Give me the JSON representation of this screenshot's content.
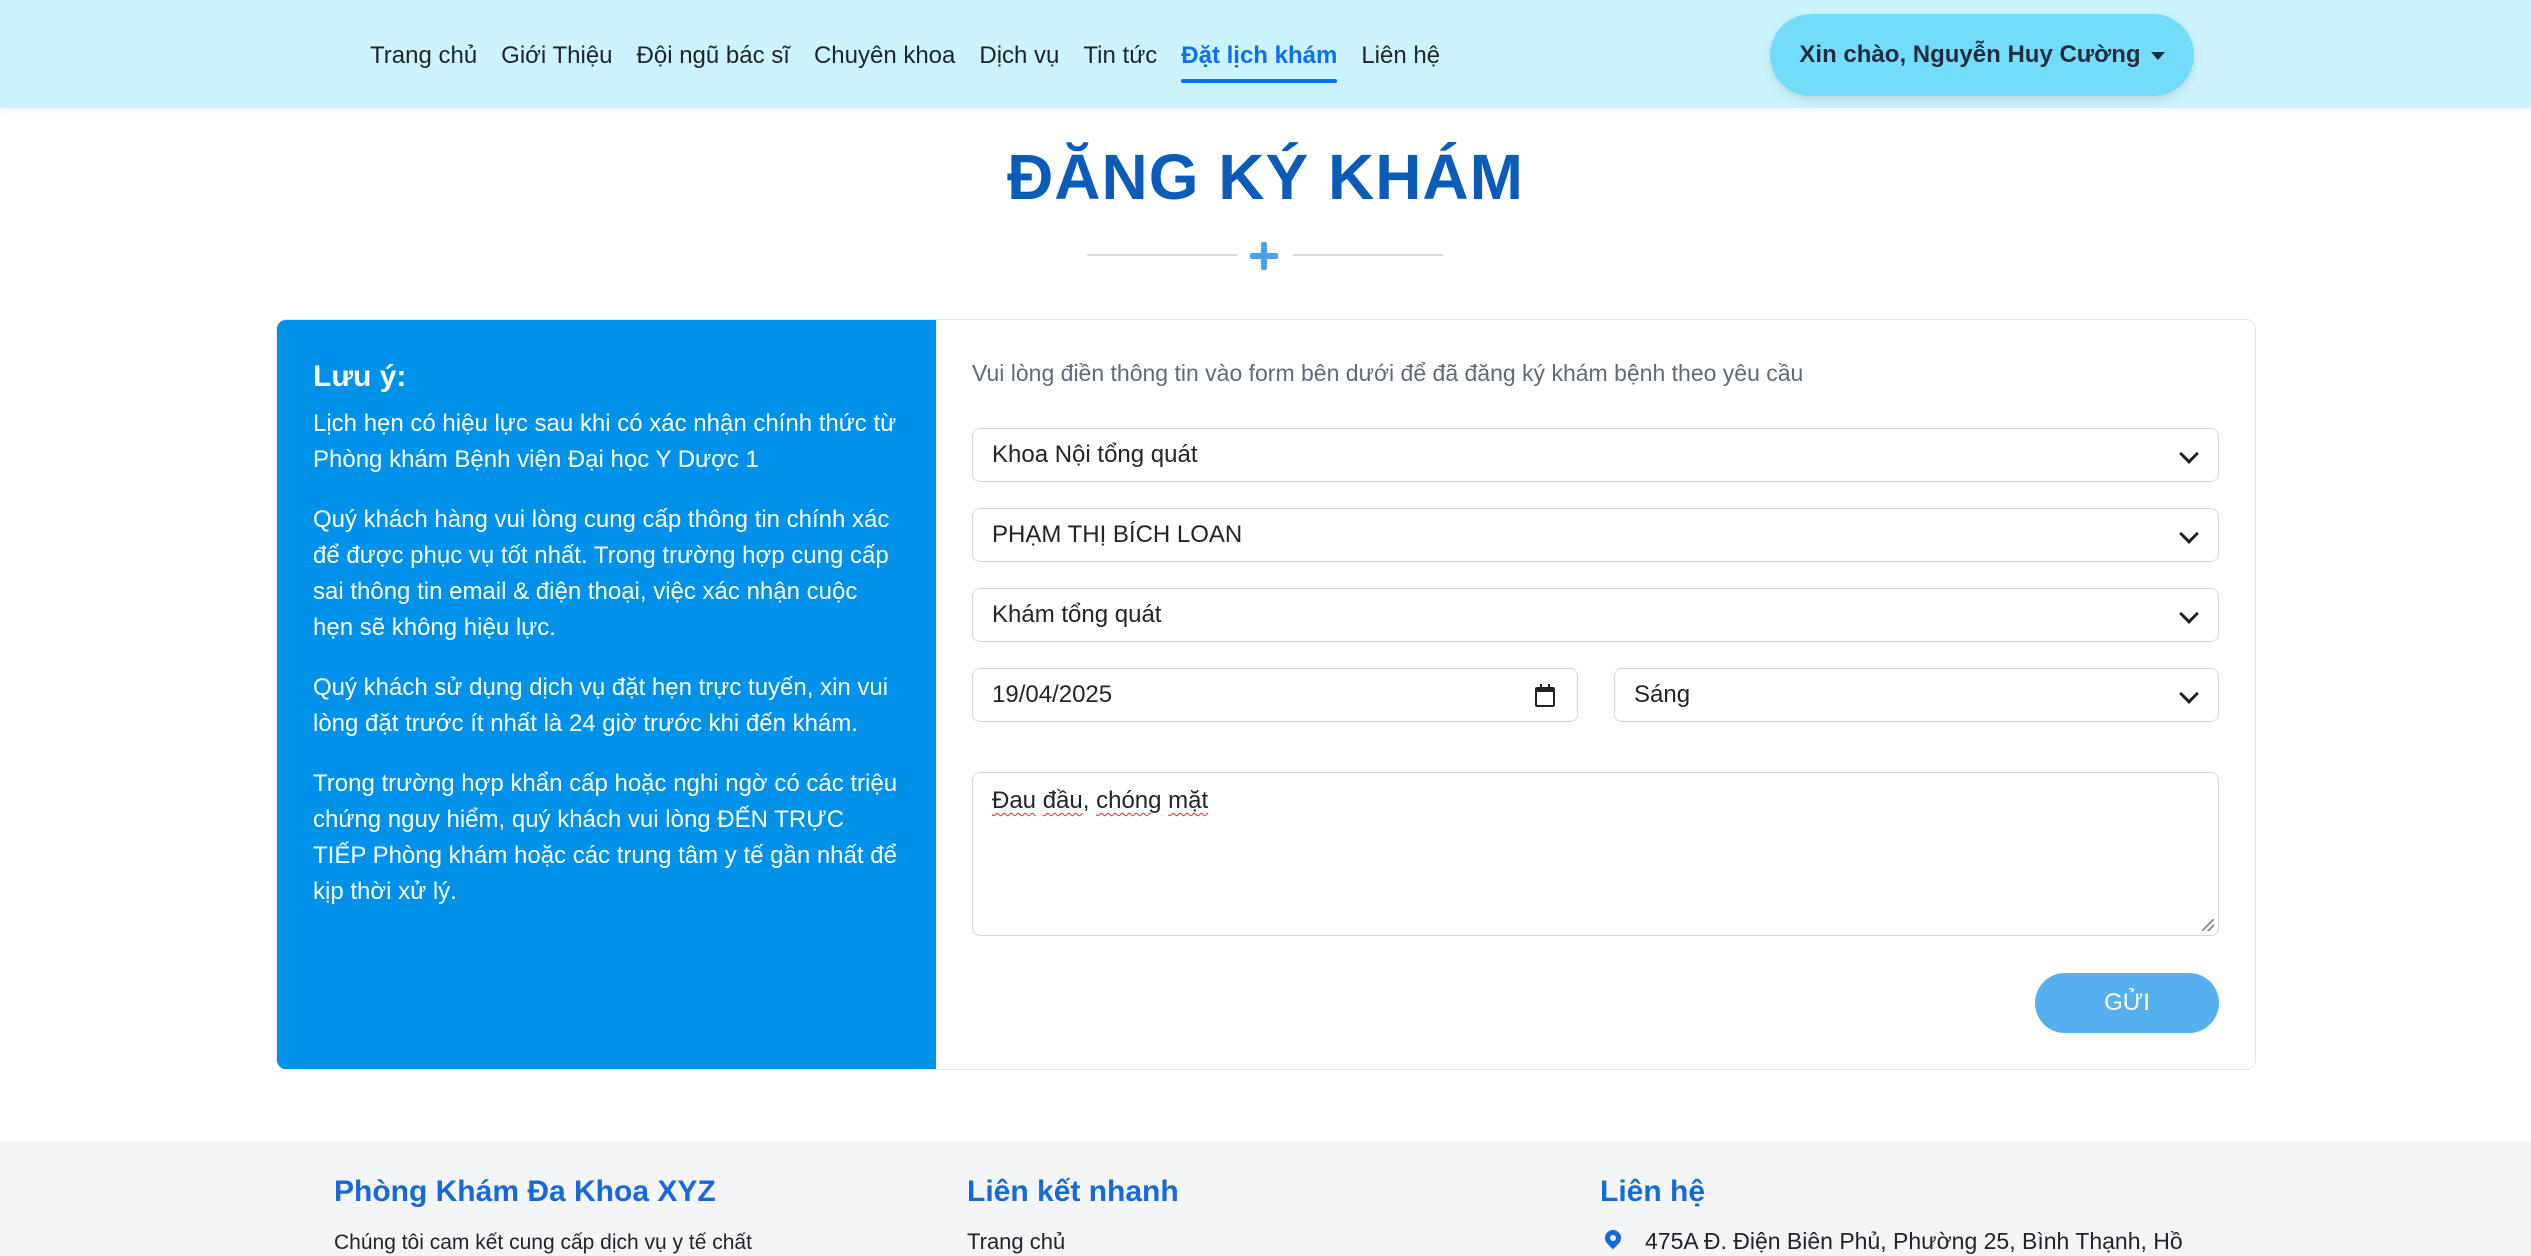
{
  "nav": {
    "items": [
      {
        "label": "Trang chủ"
      },
      {
        "label": "Giới Thiệu"
      },
      {
        "label": "Đội ngũ bác sĩ"
      },
      {
        "label": "Chuyên khoa"
      },
      {
        "label": "Dịch vụ"
      },
      {
        "label": "Tin tức"
      },
      {
        "label": "Đặt lịch khám",
        "active": true
      },
      {
        "label": "Liên hệ"
      }
    ],
    "user_greeting": "Xin chào, Nguyễn Huy Cường"
  },
  "page": {
    "title": "ĐĂNG KÝ KHÁM"
  },
  "note": {
    "title": "Lưu ý:",
    "paragraphs": [
      "Lịch hẹn có hiệu lực sau khi có xác nhận chính thức từ Phòng khám Bệnh viện Đại học Y Dược 1",
      "Quý khách hàng vui lòng cung cấp thông tin chính xác để được phục vụ tốt nhất. Trong trường hợp cung cấp sai thông tin email & điện thoại, việc xác nhận cuộc hẹn sẽ không hiệu lực.",
      "Quý khách sử dụng dịch vụ đặt hẹn trực tuyến, xin vui lòng đặt trước ít nhất là 24 giờ trước khi đến khám.",
      "Trong trường hợp khẩn cấp hoặc nghi ngờ có các triệu chứng nguy hiểm, quý khách vui lòng ĐẾN TRỰC TIẾP Phòng khám hoặc các trung tâm y tế gần nhất để kịp thời xử lý."
    ]
  },
  "form": {
    "intro": "Vui lòng điền thông tin vào form bên dưới để đã đăng ký khám bệnh theo yêu cầu",
    "department": "Khoa Nội tổng quát",
    "doctor": "PHẠM THỊ BÍCH LOAN",
    "service": "Khám tổng quát",
    "date": "19/04/2025",
    "session": "Sáng",
    "symptoms_word1": "Đau",
    "symptoms_word2": "đầu",
    "symptoms_sep": ", ",
    "symptoms_word3": "chóng",
    "symptoms_space": " ",
    "symptoms_word4": "mặt",
    "submit_label": "GỬI"
  },
  "footer": {
    "col1": {
      "heading": "Phòng Khám Đa Khoa XYZ",
      "text": "Chúng tôi cam kết cung cấp dịch vụ y tế chất"
    },
    "col2": {
      "heading": "Liên kết nhanh",
      "first_link": "Trang chủ"
    },
    "col3": {
      "heading": "Liên hệ",
      "address": "475A Đ. Điện Biên Phủ, Phường 25, Bình Thạnh, Hồ"
    }
  },
  "colors": {
    "navbar_bg": "#ccf4fc",
    "accent": "#0d6efd",
    "title": "#0a5cb8",
    "note_panel": "#0091ea",
    "submit": "#56b0ef"
  }
}
